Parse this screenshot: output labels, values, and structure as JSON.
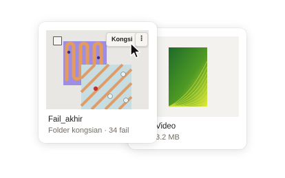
{
  "files": [
    {
      "name": "Fail_akhir",
      "meta": "Folder kongsian · 34 fail",
      "icon": "folder-collage-thumbnail"
    },
    {
      "name": "Video",
      "meta": "3.2 MB",
      "icon": "video-gradient-thumbnail"
    }
  ],
  "actions": {
    "share_label": "Kongsi",
    "more_label": "⋮"
  },
  "colors": {
    "accent_purple": "#9d8ee3",
    "tube_orange": "#e59a5e",
    "stripe_blue": "#a9c4cc",
    "video_green": "#2d7a2d",
    "video_lime": "#d6e62a"
  }
}
